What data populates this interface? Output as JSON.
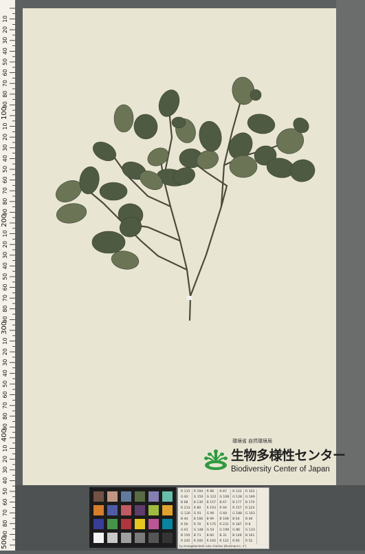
{
  "ruler": {
    "labels": [
      "10",
      "20",
      "30",
      "40",
      "50",
      "60",
      "70",
      "80",
      "90",
      "100",
      "10",
      "20",
      "30",
      "40",
      "50",
      "60",
      "70",
      "80",
      "90",
      "200",
      "10",
      "20",
      "30",
      "40",
      "50",
      "60",
      "70",
      "80",
      "90",
      "300",
      "10",
      "20",
      "30",
      "40",
      "50",
      "60",
      "70",
      "80",
      "90",
      "400",
      "10",
      "20",
      "30",
      "40",
      "50",
      "60",
      "70",
      "80",
      "90",
      "500"
    ]
  },
  "logo": {
    "ministry": "環境省 自然環境局",
    "title_jp": "生物多様性センター",
    "title_en": "Biodiversity Center of Japan"
  },
  "color_card": {
    "rows": [
      [
        "R 115",
        "R 194",
        "R 98",
        "R 87",
        "R 133",
        "R 103"
      ],
      [
        "G 82",
        "G 150",
        "G 122",
        "G 108",
        "G 128",
        "G 189"
      ],
      [
        "B 68",
        "B 130",
        "B 157",
        "B 67",
        "B 177",
        "B 170"
      ],
      [
        "R 214",
        "R 80",
        "R 193",
        "R 94",
        "R 157",
        "R 224"
      ],
      [
        "G 126",
        "G 91",
        "G 90",
        "G 60",
        "G 188",
        "G 163"
      ],
      [
        "B 44",
        "B 166",
        "B 99",
        "B 108",
        "B 64",
        "B 46"
      ],
      [
        "R 56",
        "R 70",
        "R 175",
        "R 231",
        "R 187",
        "R 8"
      ],
      [
        "G 61",
        "G 148",
        "G 54",
        "G 199",
        "G 86",
        "G 133"
      ],
      [
        "B 150",
        "B 73",
        "B 60",
        "B 31",
        "B 149",
        "B 161"
      ],
      [
        "R 245",
        "R 200",
        "R 160",
        "R 122",
        "R 85",
        "R 52"
      ]
    ],
    "footer": "by GretagMacbeth color checker (Illuminant C, 2°)"
  },
  "swatch_colors": [
    "#735244",
    "#c29682",
    "#627a9d",
    "#576c43",
    "#8580b1",
    "#67bdaa",
    "#d67e2c",
    "#505ba6",
    "#c15a63",
    "#5e3c6c",
    "#9dbc40",
    "#e0a32e",
    "#383d96",
    "#469449",
    "#af363c",
    "#e7c71f",
    "#bb5695",
    "#0885a1",
    "#f3f3f2",
    "#c8c8c8",
    "#a0a0a0",
    "#7a7a79",
    "#555555",
    "#343434"
  ],
  "colors": {
    "sheet": "#e9e5d3",
    "leaf": "#4f5a42",
    "leaf_light": "#6b7556",
    "stem": "#4b4a3a"
  }
}
